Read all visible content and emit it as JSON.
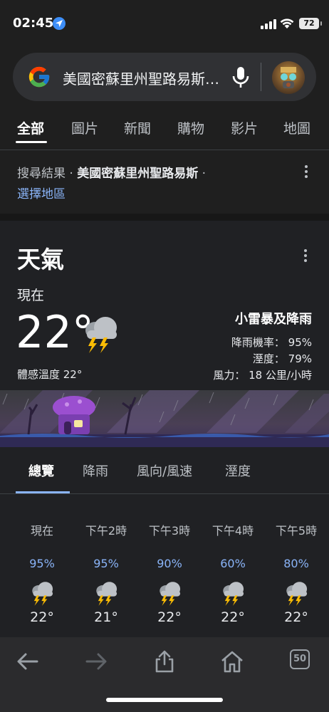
{
  "status": {
    "time": "02:45",
    "battery": "72"
  },
  "search": {
    "query": "美國密蘇里州聖路易斯天氣"
  },
  "tabs": [
    {
      "label": "全部"
    },
    {
      "label": "圖片"
    },
    {
      "label": "新聞"
    },
    {
      "label": "購物"
    },
    {
      "label": "影片"
    },
    {
      "label": "地圖"
    }
  ],
  "result_header": {
    "prefix": "搜尋結果",
    "sep": " · ",
    "location": "美國密蘇里州聖路易斯",
    "sep2": " · ",
    "link": "選擇地區"
  },
  "weather": {
    "title": "天氣",
    "now_label": "現在",
    "temp": "22°",
    "feels": "體感溫度 22°",
    "condition": "小雷暴及降雨",
    "precip": "降雨機率： 95%",
    "humidity": "溼度： 79%",
    "wind": "風力： 18 公里/小時",
    "tabs": [
      "總覽",
      "降雨",
      "風向/風速",
      "溼度"
    ],
    "hours": [
      {
        "label": "現在",
        "pct": "95%",
        "temp": "22°"
      },
      {
        "label": "下午2時",
        "pct": "95%",
        "temp": "21°"
      },
      {
        "label": "下午3時",
        "pct": "90%",
        "temp": "22°"
      },
      {
        "label": "下午4時",
        "pct": "60%",
        "temp": "22°"
      },
      {
        "label": "下午5時",
        "pct": "80%",
        "temp": "22°"
      }
    ]
  },
  "toolbar": {
    "tab_count": "50"
  },
  "colors": {
    "accent": "#8ab4f8",
    "background": "#1f1f1f",
    "card": "#202124"
  }
}
